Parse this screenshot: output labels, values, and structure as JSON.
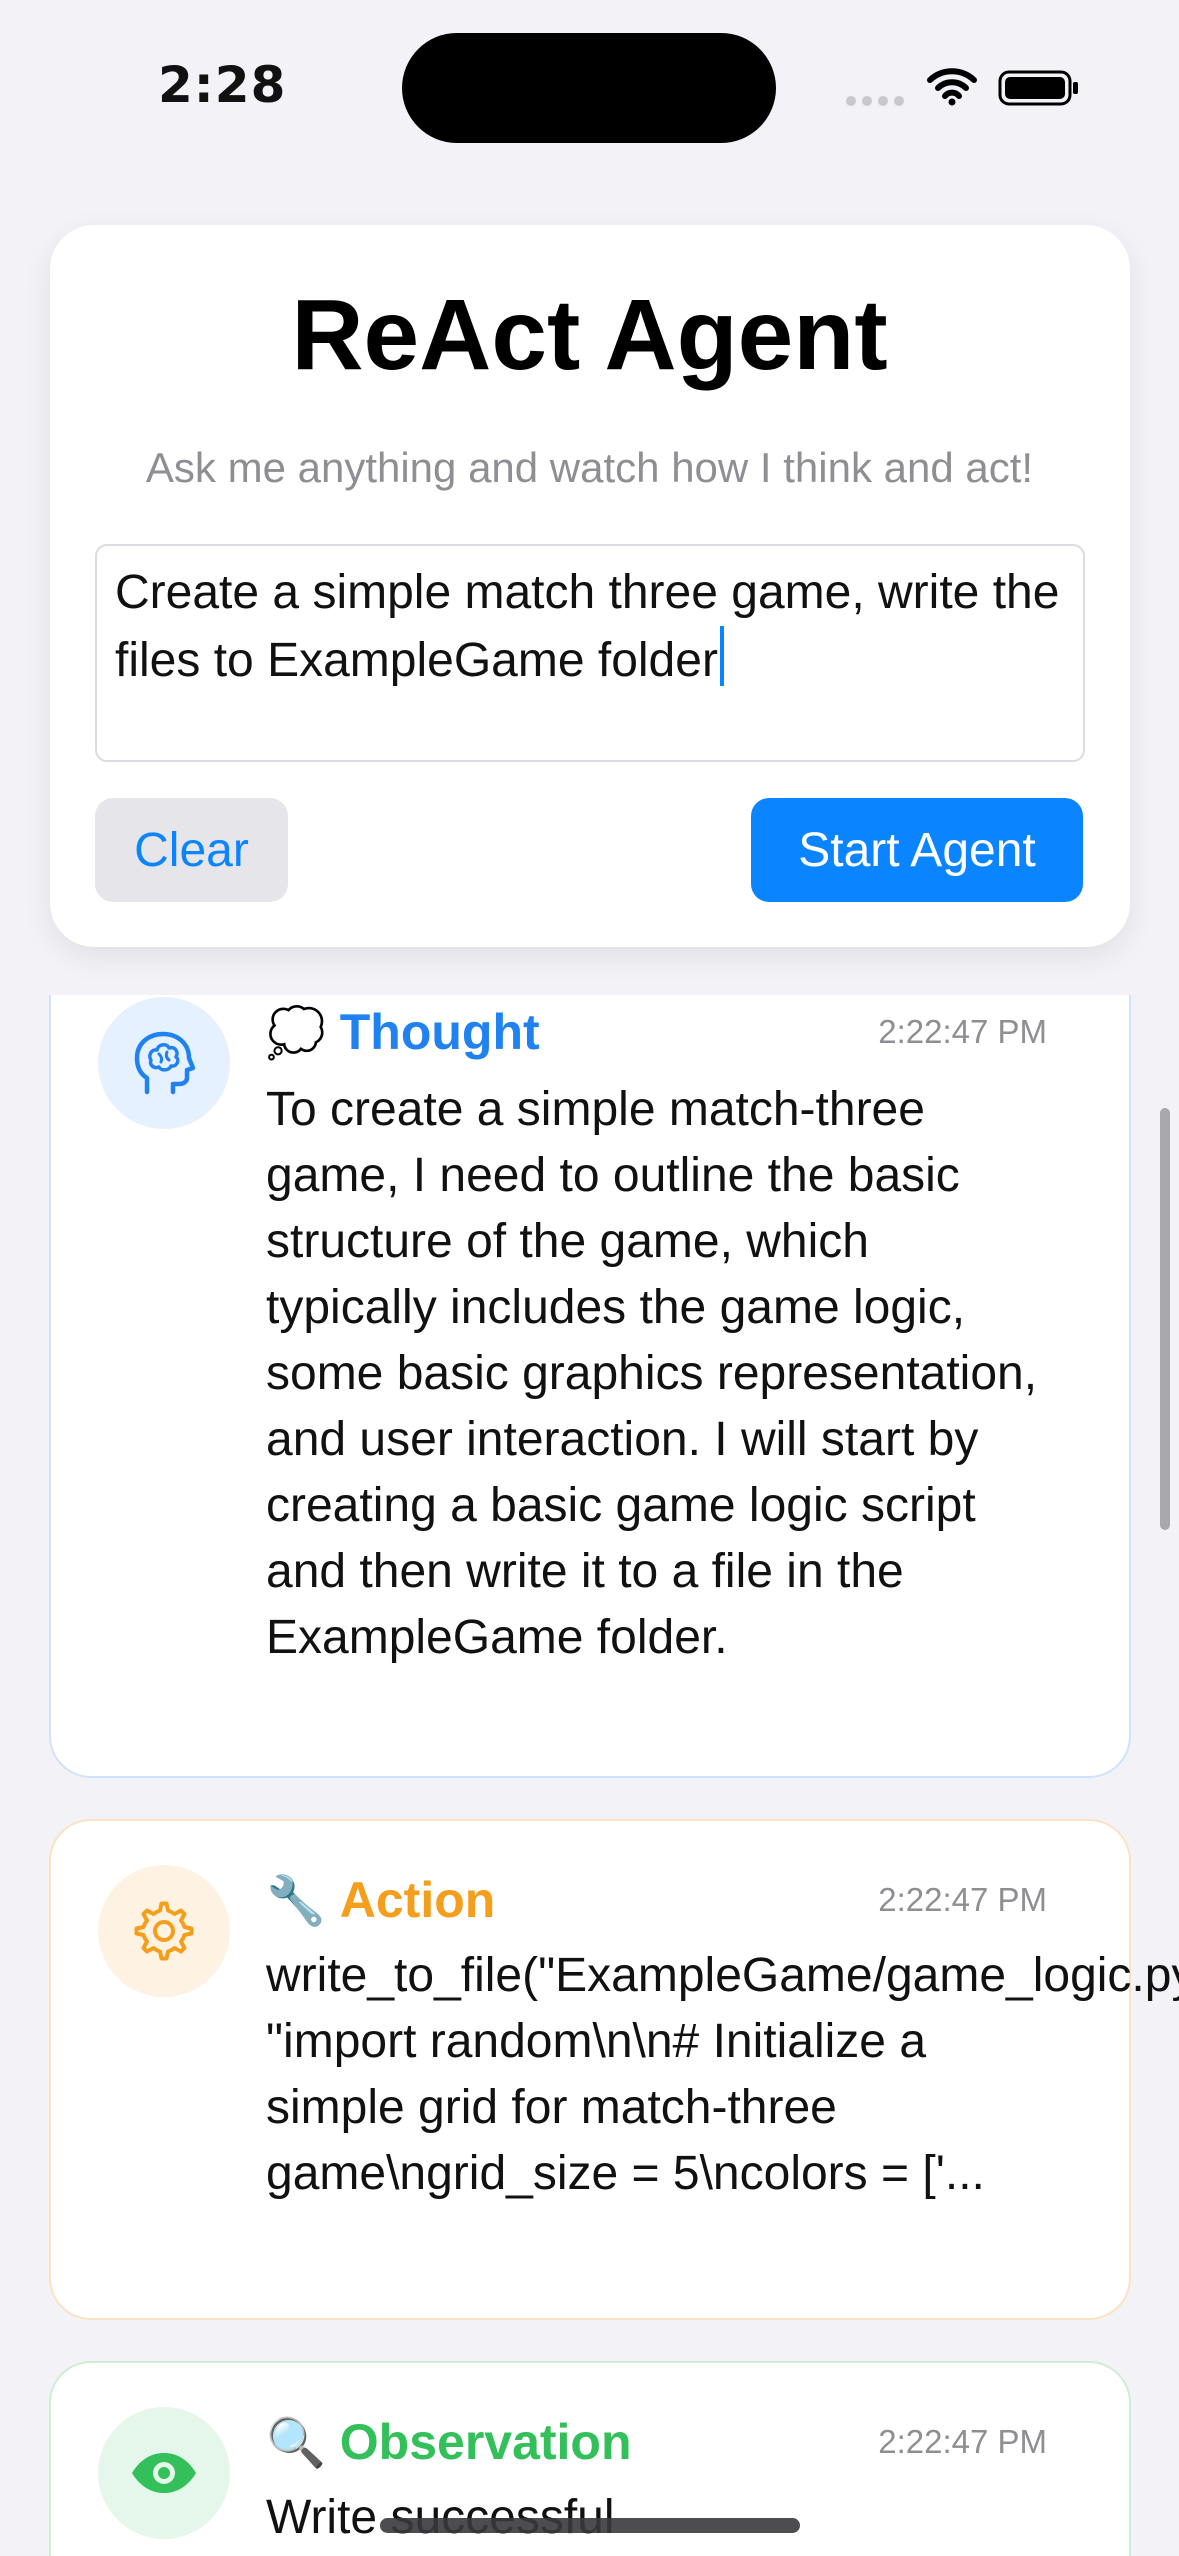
{
  "status_bar": {
    "time": "2:28"
  },
  "header": {
    "title": "ReAct Agent",
    "subtitle": "Ask me anything and watch how I think and act!",
    "input_value": "Create a simple match three game, write the files to ExampleGame folder",
    "clear_label": "Clear",
    "start_label": "Start Agent"
  },
  "steps": [
    {
      "type": "Thought",
      "emoji": "💭",
      "icon": "brain-head-icon",
      "time": "2:22:47 PM",
      "text": "To create a simple match-three game, I need to outline the basic structure of the game, which typically includes the game logic, some basic graphics representation, and user interaction. I will start by creating a basic game logic script and then write it to a file in the ExampleGame folder.",
      "color": "#1f82f0"
    },
    {
      "type": "Action",
      "emoji": "🔧",
      "icon": "gear-icon",
      "time": "2:22:47 PM",
      "text": "write_to_file(\"ExampleGame/game_logic.py\", \"import random\\n\\n# Initialize a simple grid for match-three game\\ngrid_size = 5\\ncolors = ['...",
      "color": "#f59e1b"
    },
    {
      "type": "Observation",
      "emoji": "🔍",
      "icon": "eye-icon",
      "time": "2:22:47 PM",
      "text": "Write successful",
      "color": "#33c05a"
    }
  ]
}
